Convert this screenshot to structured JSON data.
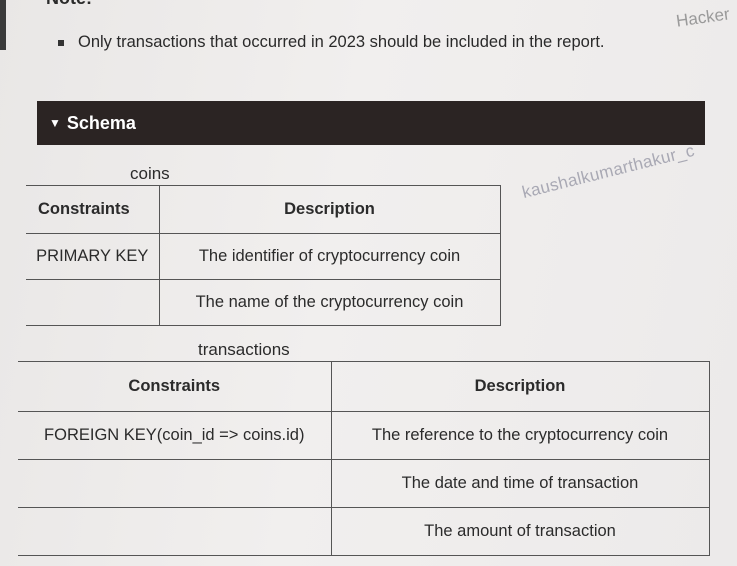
{
  "note": {
    "heading": "Note:",
    "bullet": "Only transactions that occurred in 2023 should be included in the report."
  },
  "brand_watermark": "Hacker",
  "watermark_user": "kaushalkumarthakur_c",
  "schema": {
    "toggle_icon": "caret-down-icon",
    "label": "Schema"
  },
  "coins_table": {
    "name": "coins",
    "headers": [
      "Constraints",
      "Description"
    ],
    "rows": [
      [
        "PRIMARY KEY",
        "The identifier of cryptocurrency coin"
      ],
      [
        "",
        "The name of the cryptocurrency coin"
      ]
    ]
  },
  "transactions_table": {
    "name": "transactions",
    "headers": [
      "Constraints",
      "Description"
    ],
    "rows": [
      [
        "FOREIGN KEY(coin_id => coins.id)",
        "The reference to the cryptocurrency coin"
      ],
      [
        "",
        "The date and time of transaction"
      ],
      [
        "",
        "The amount of transaction"
      ]
    ]
  }
}
